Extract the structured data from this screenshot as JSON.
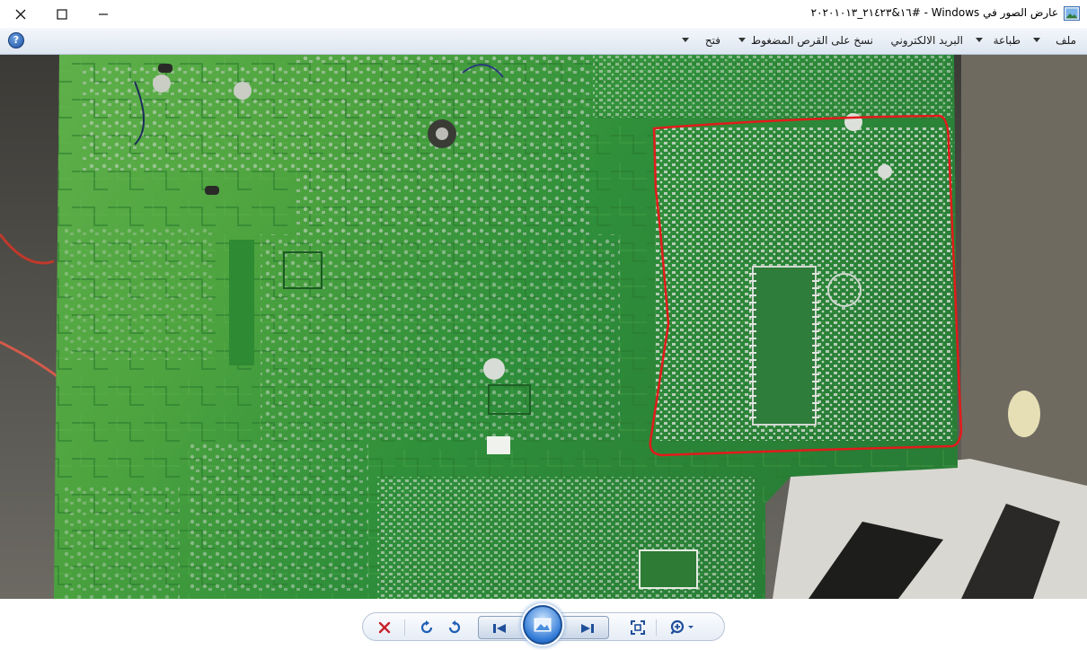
{
  "window": {
    "title": "عارض الصور في Windows - #١٦&٢١٤٢٣_٢٠٢٠١٠١٣",
    "controls": {
      "close": "✕",
      "maximize": "☐",
      "minimize": "—"
    }
  },
  "menu": {
    "items": [
      {
        "label": "ملف"
      },
      {
        "label": "طباعة"
      },
      {
        "label": "البريد الالكتروني"
      },
      {
        "label": "نسخ على القرص المضغوط"
      },
      {
        "label": "فتح"
      }
    ],
    "help": "?"
  },
  "photo": {
    "annotation_color": "#e21b1b",
    "board_color": "#3d9a3a"
  },
  "toolbar": {
    "delete_color": "#c8202b",
    "accent": "#1f5fb4"
  }
}
